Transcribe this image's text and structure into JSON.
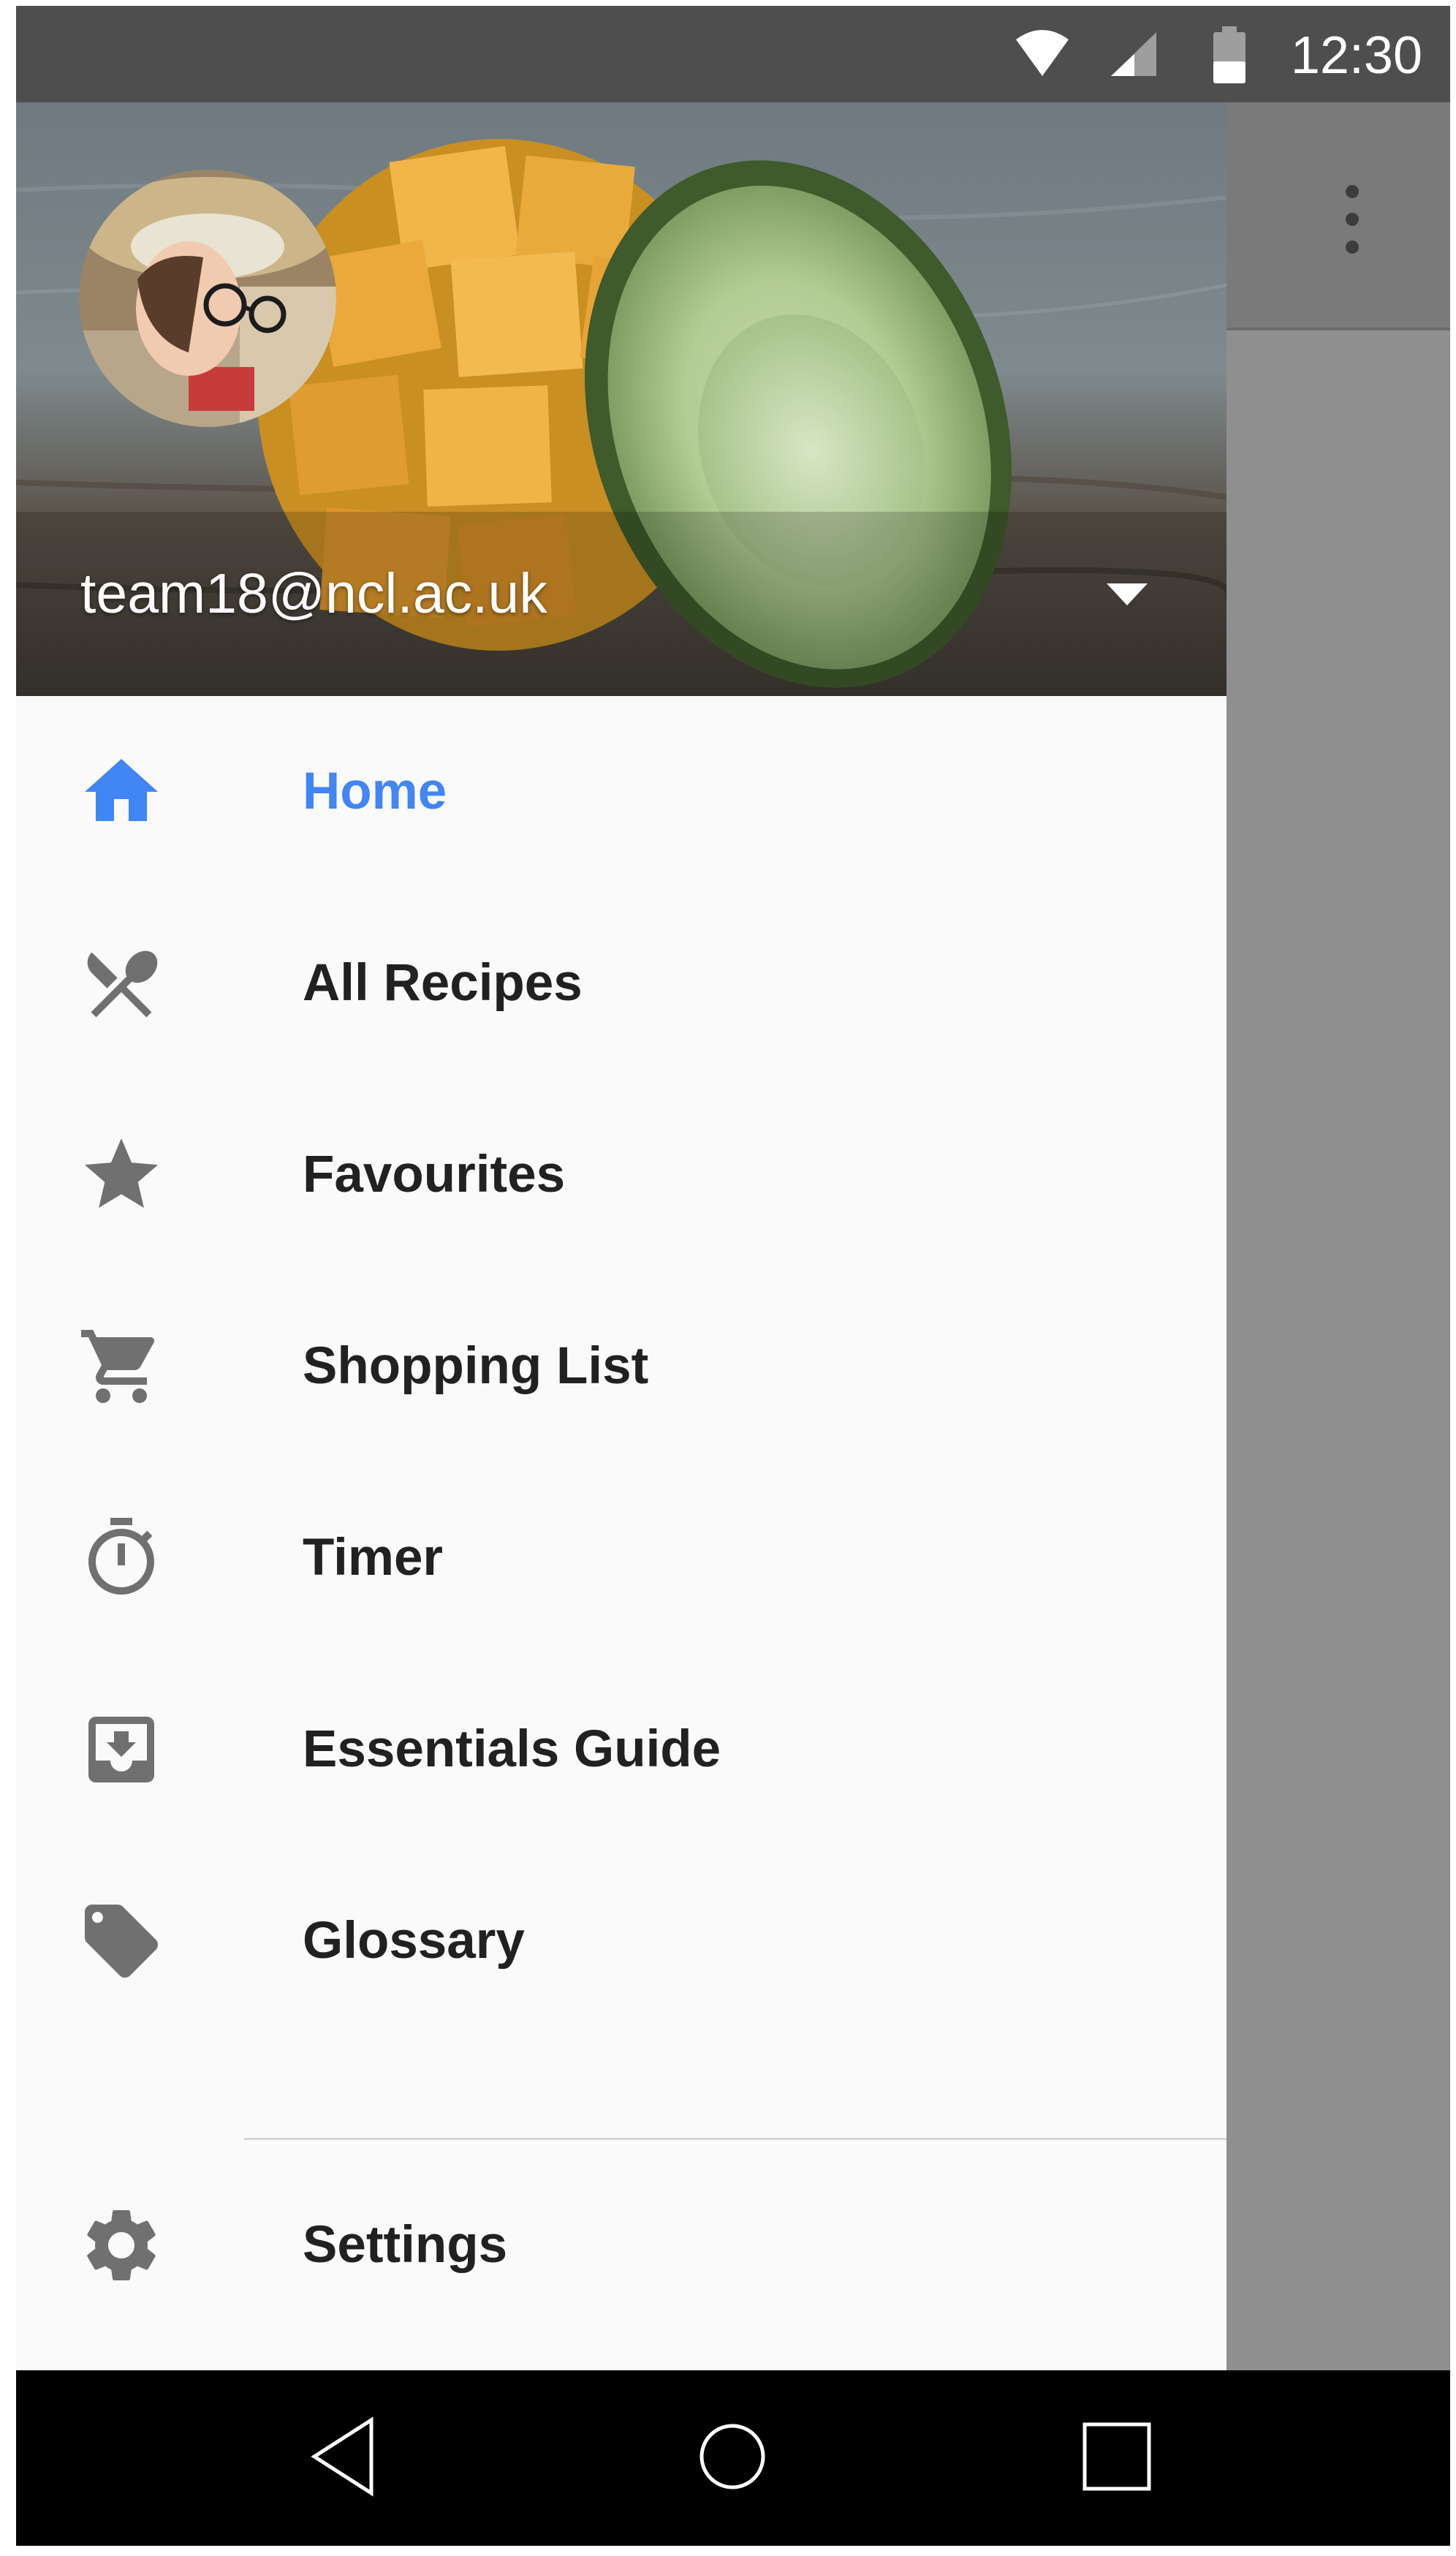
{
  "status_bar": {
    "time": "12:30",
    "icons": [
      "wifi-icon",
      "cellular-signal-icon",
      "battery-icon"
    ],
    "background": "#4e4e4e"
  },
  "toolbar": {
    "overflow_icon": "more-vert-icon"
  },
  "drawer": {
    "header": {
      "email": "team18@ncl.ac.uk",
      "avatar": "profile-photo",
      "dropdown_icon": "arrow-drop-down-icon",
      "background_image": "mango-and-avocado-photo"
    },
    "items": [
      {
        "label": "Home",
        "icon": "home-icon",
        "active": true
      },
      {
        "label": "All Recipes",
        "icon": "restaurant-icon",
        "active": false
      },
      {
        "label": "Favourites",
        "icon": "star-icon",
        "active": false
      },
      {
        "label": "Shopping List",
        "icon": "shopping-cart-icon",
        "active": false
      },
      {
        "label": "Timer",
        "icon": "timer-icon",
        "active": false
      },
      {
        "label": "Essentials Guide",
        "icon": "move-to-inbox-icon",
        "active": false
      },
      {
        "label": "Glossary",
        "icon": "label-tag-icon",
        "active": false
      }
    ],
    "footer_items": [
      {
        "label": "Settings",
        "icon": "settings-icon"
      }
    ]
  },
  "navigation_bar": {
    "buttons": [
      "back-icon",
      "home-circle-icon",
      "recents-square-icon"
    ]
  },
  "colors": {
    "active": "#4285f4",
    "text": "#212121",
    "icon": "#707070",
    "drawer_background": "#fafafa",
    "scrim": "#8f8f8f"
  }
}
